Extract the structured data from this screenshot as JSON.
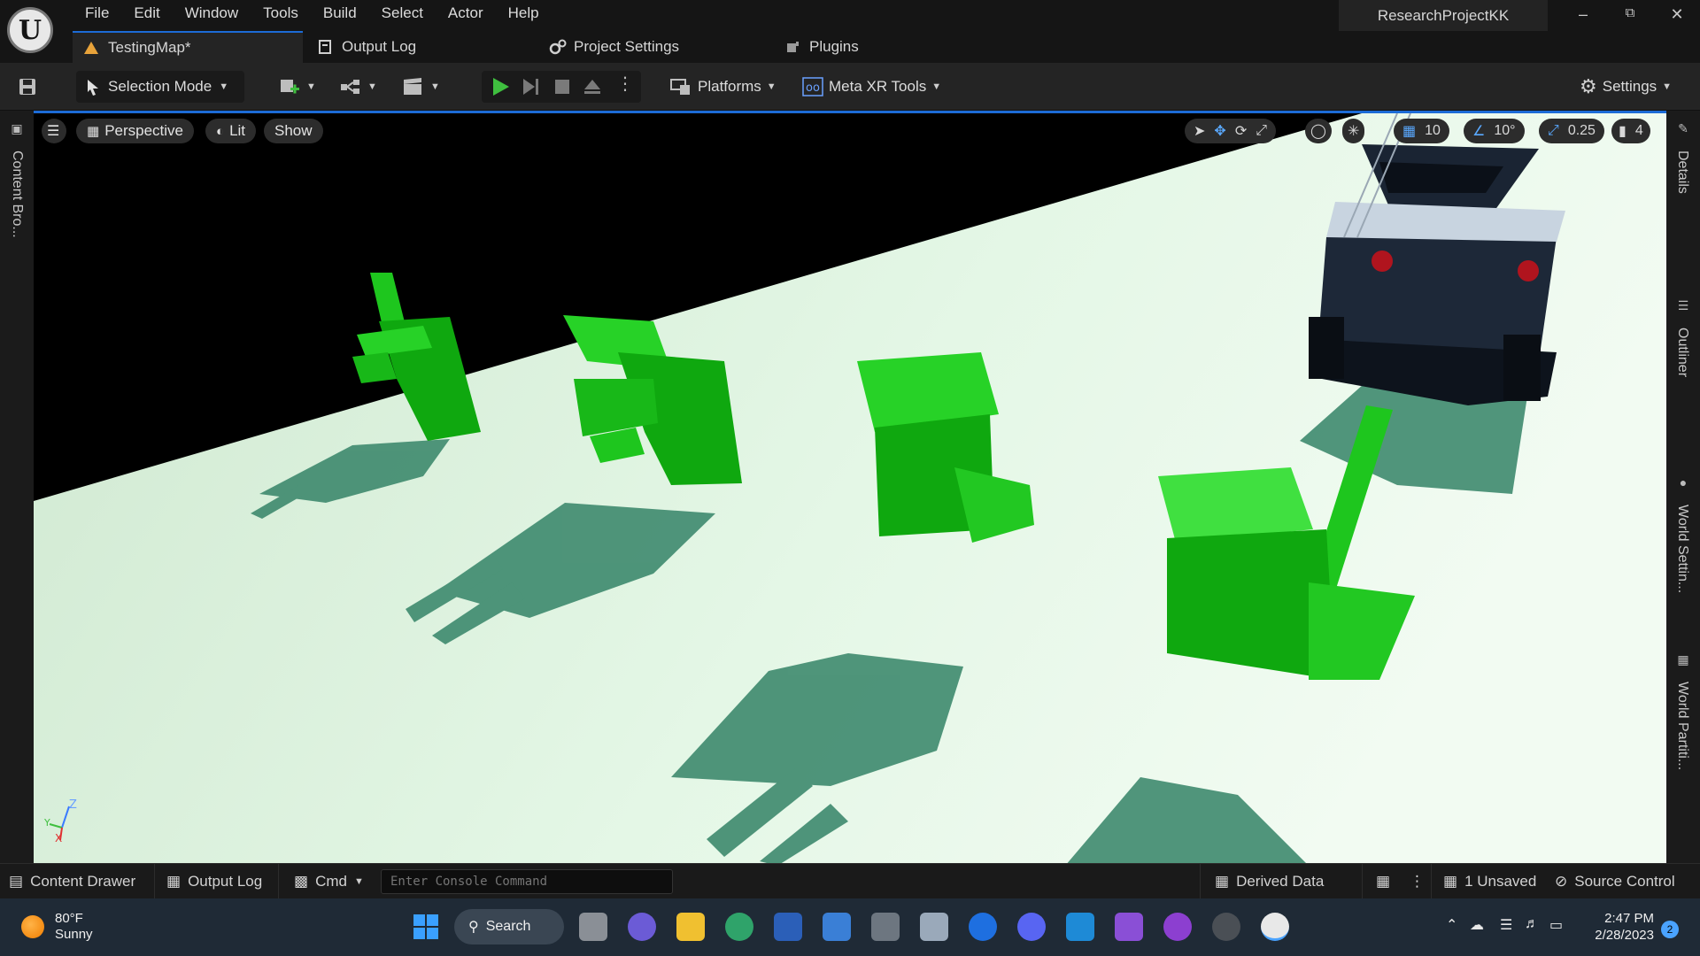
{
  "app": {
    "project_name": "ResearchProjectKK",
    "menu": [
      "File",
      "Edit",
      "Window",
      "Tools",
      "Build",
      "Select",
      "Actor",
      "Help"
    ]
  },
  "tabs": [
    {
      "label": "TestingMap*",
      "icon": "level-icon",
      "active": true
    },
    {
      "label": "Output Log",
      "icon": "log-icon",
      "active": false
    },
    {
      "label": "Project Settings",
      "icon": "settings-gears-icon",
      "active": false
    },
    {
      "label": "Plugins",
      "icon": "plugin-icon",
      "active": false
    }
  ],
  "toolbar": {
    "selection_mode": "Selection Mode",
    "platforms": "Platforms",
    "meta_xr": "Meta XR Tools",
    "settings": "Settings"
  },
  "viewport": {
    "perspective": "Perspective",
    "lit": "Lit",
    "show": "Show",
    "grid_snap": "10",
    "rotation_snap": "10°",
    "scale_snap": "0.25",
    "camera_speed": "4",
    "axis_z": "Z",
    "axis_x": "X",
    "axis_y": "Y"
  },
  "right_panels": [
    "Details",
    "Outliner",
    "World Settin...",
    "World Partiti..."
  ],
  "left_panel": "Content Bro...",
  "statusbar": {
    "content_drawer": "Content Drawer",
    "output_log": "Output Log",
    "cmd": "Cmd",
    "console_placeholder": "Enter Console Command",
    "derived_data": "Derived Data",
    "unsaved": "1 Unsaved",
    "source_control": "Source Control"
  },
  "taskbar": {
    "temperature": "80°F",
    "condition": "Sunny",
    "search": "Search",
    "time": "2:47 PM",
    "date": "2/28/2023",
    "notifications": "2"
  },
  "colors": {
    "accent": "#1c6bd6",
    "play_green": "#3fbf3f",
    "hand_green": "#12b012",
    "floor": "#d8f0dc"
  }
}
